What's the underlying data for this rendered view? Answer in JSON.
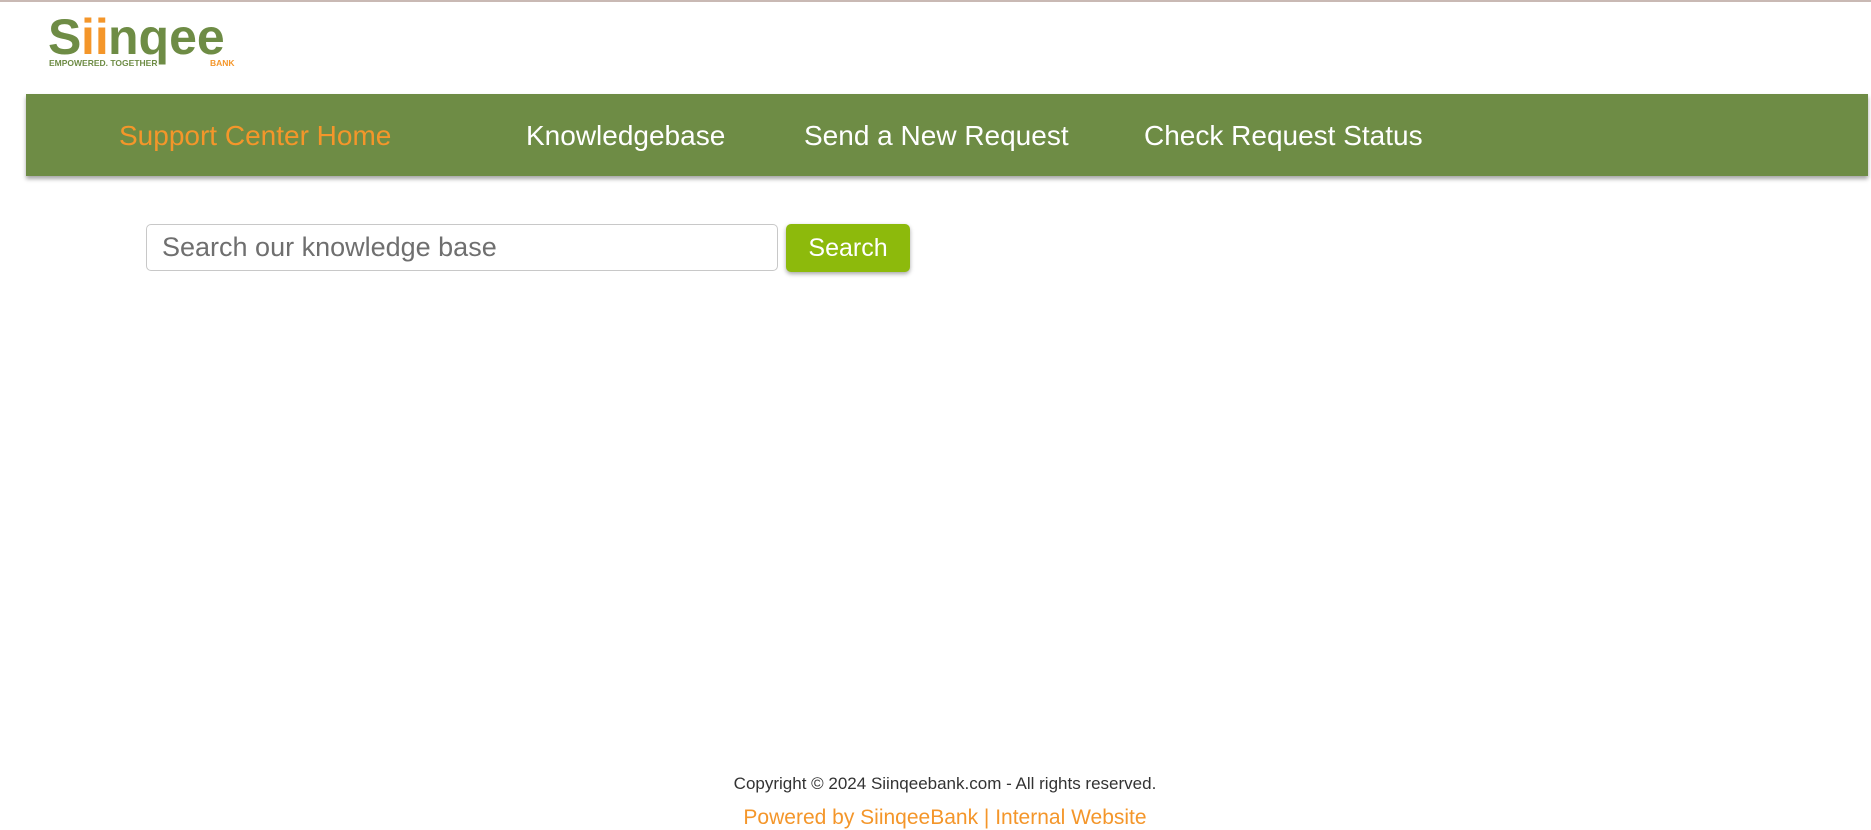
{
  "colors": {
    "brand_green": "#6e8c45",
    "brand_orange": "#f4962a",
    "search_button": "#8dba0c"
  },
  "logo": {
    "name": "Siinqee",
    "tagline": "EMPOWERED. TOGETHER",
    "suffix": "BANK"
  },
  "nav": {
    "items": [
      {
        "label": "Support Center Home",
        "active": true
      },
      {
        "label": "Knowledgebase",
        "active": false
      },
      {
        "label": "Send a New Request",
        "active": false
      },
      {
        "label": "Check Request Status",
        "active": false
      }
    ]
  },
  "search": {
    "placeholder": "Search our knowledge base",
    "value": "",
    "button_label": "Search"
  },
  "footer": {
    "copyright": "Copyright © 2024 Siinqeebank.com - All rights reserved.",
    "powered_by": "Powered by SiinqeeBank",
    "separator": " | ",
    "internal_link": "Internal Website"
  }
}
